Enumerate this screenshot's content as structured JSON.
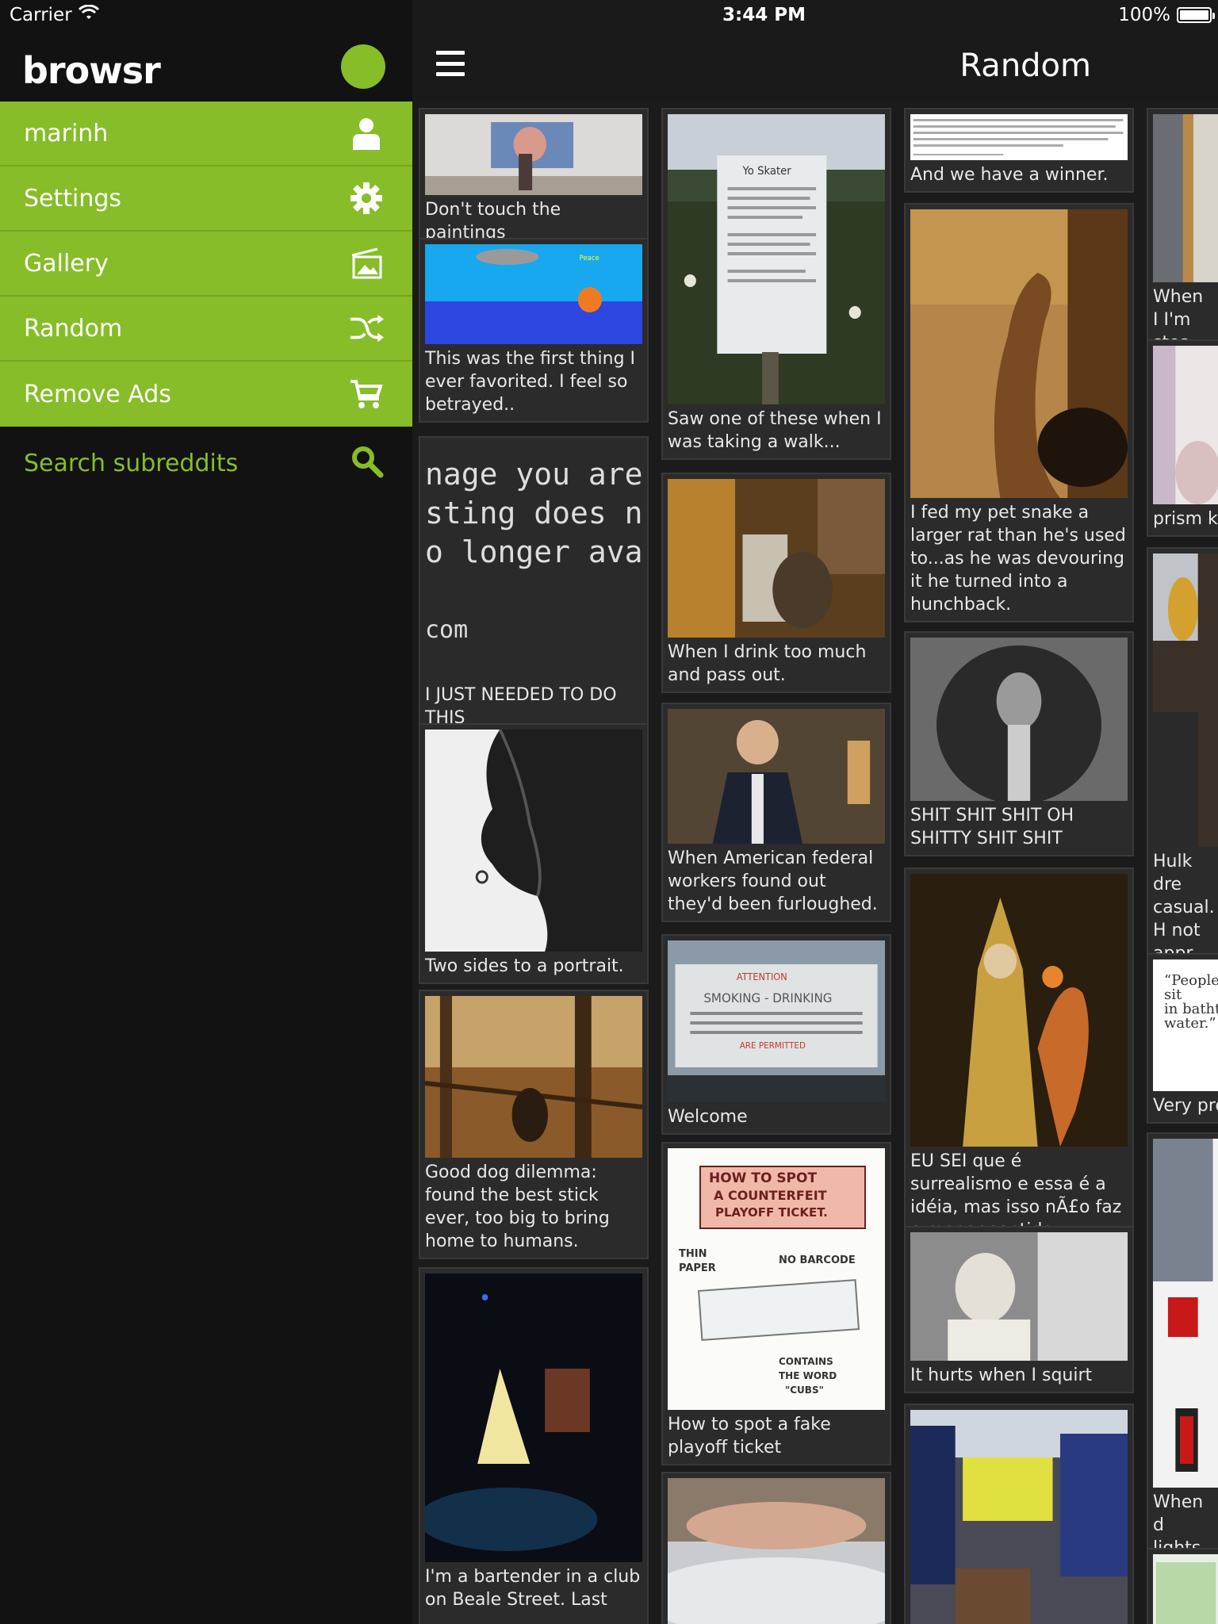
{
  "status_bar": {
    "carrier": "Carrier",
    "time": "3:44 PM",
    "battery": "100%"
  },
  "sidebar": {
    "brand": "browsr",
    "items": [
      {
        "label": "marinh",
        "icon": "user-icon"
      },
      {
        "label": "Settings",
        "icon": "gear-icon"
      },
      {
        "label": "Gallery",
        "icon": "gallery-icon"
      },
      {
        "label": "Random",
        "icon": "shuffle-icon"
      },
      {
        "label": "Remove Ads",
        "icon": "cart-icon"
      }
    ],
    "search_label": "Search subreddits",
    "accent": "#86bd28"
  },
  "header": {
    "title": "Random"
  },
  "cards": [
    {
      "caption": "Don't touch the paintings"
    },
    {
      "caption": "This was the first thing I ever favorited. I feel so betrayed.."
    },
    {
      "caption": "I JUST NEEDED TO DO THIS",
      "thumb_text": [
        "nage you are",
        "sting does no",
        "o longer avail",
        "",
        "com"
      ]
    },
    {
      "caption": "Two sides to a portrait."
    },
    {
      "caption": "Good dog dilemma: found the best stick ever, too big to bring home to humans."
    },
    {
      "caption": "I'm a bartender in a club on Beale Street. Last"
    },
    {
      "caption": "Saw one of these when I was taking a walk..."
    },
    {
      "caption": "When I drink too much and pass out."
    },
    {
      "caption": "When American federal workers found out they'd been furloughed."
    },
    {
      "caption": "Welcome"
    },
    {
      "caption": "How to spot a fake playoff ticket",
      "thumb_text": [
        "HOW TO SPOT",
        "A COUNTERFEIT",
        "PLAYOFF TICKET.",
        "THIN",
        "PAPER",
        "NO BARCODE",
        "CONTAINS",
        "THE WORD",
        "\"CUBS\""
      ]
    },
    {
      "caption": ""
    },
    {
      "caption": "And we have a winner."
    },
    {
      "caption": "I fed my pet snake a larger rat than he's used to...as he was devouring it he turned into a hunchback."
    },
    {
      "caption": "SHIT SHIT SHIT OH SHITTY SHIT SHIT"
    },
    {
      "caption": "EU SEI que é surrealismo e essa é a idéia, mas isso nÃ£o faz o menor sentido"
    },
    {
      "caption": "It hurts when I squirt"
    },
    {
      "caption": ""
    },
    {
      "caption": "When I I'm stea"
    },
    {
      "caption": "prism ki"
    },
    {
      "caption": "Hulk dre casual. H not appr workpla",
      "thumb_text": []
    },
    {
      "caption": "Very pro",
      "thumb_text": [
        "“People",
        "sit",
        "in bathtu",
        "water.”"
      ]
    },
    {
      "caption": "When d lights go"
    },
    {
      "caption": ""
    }
  ]
}
